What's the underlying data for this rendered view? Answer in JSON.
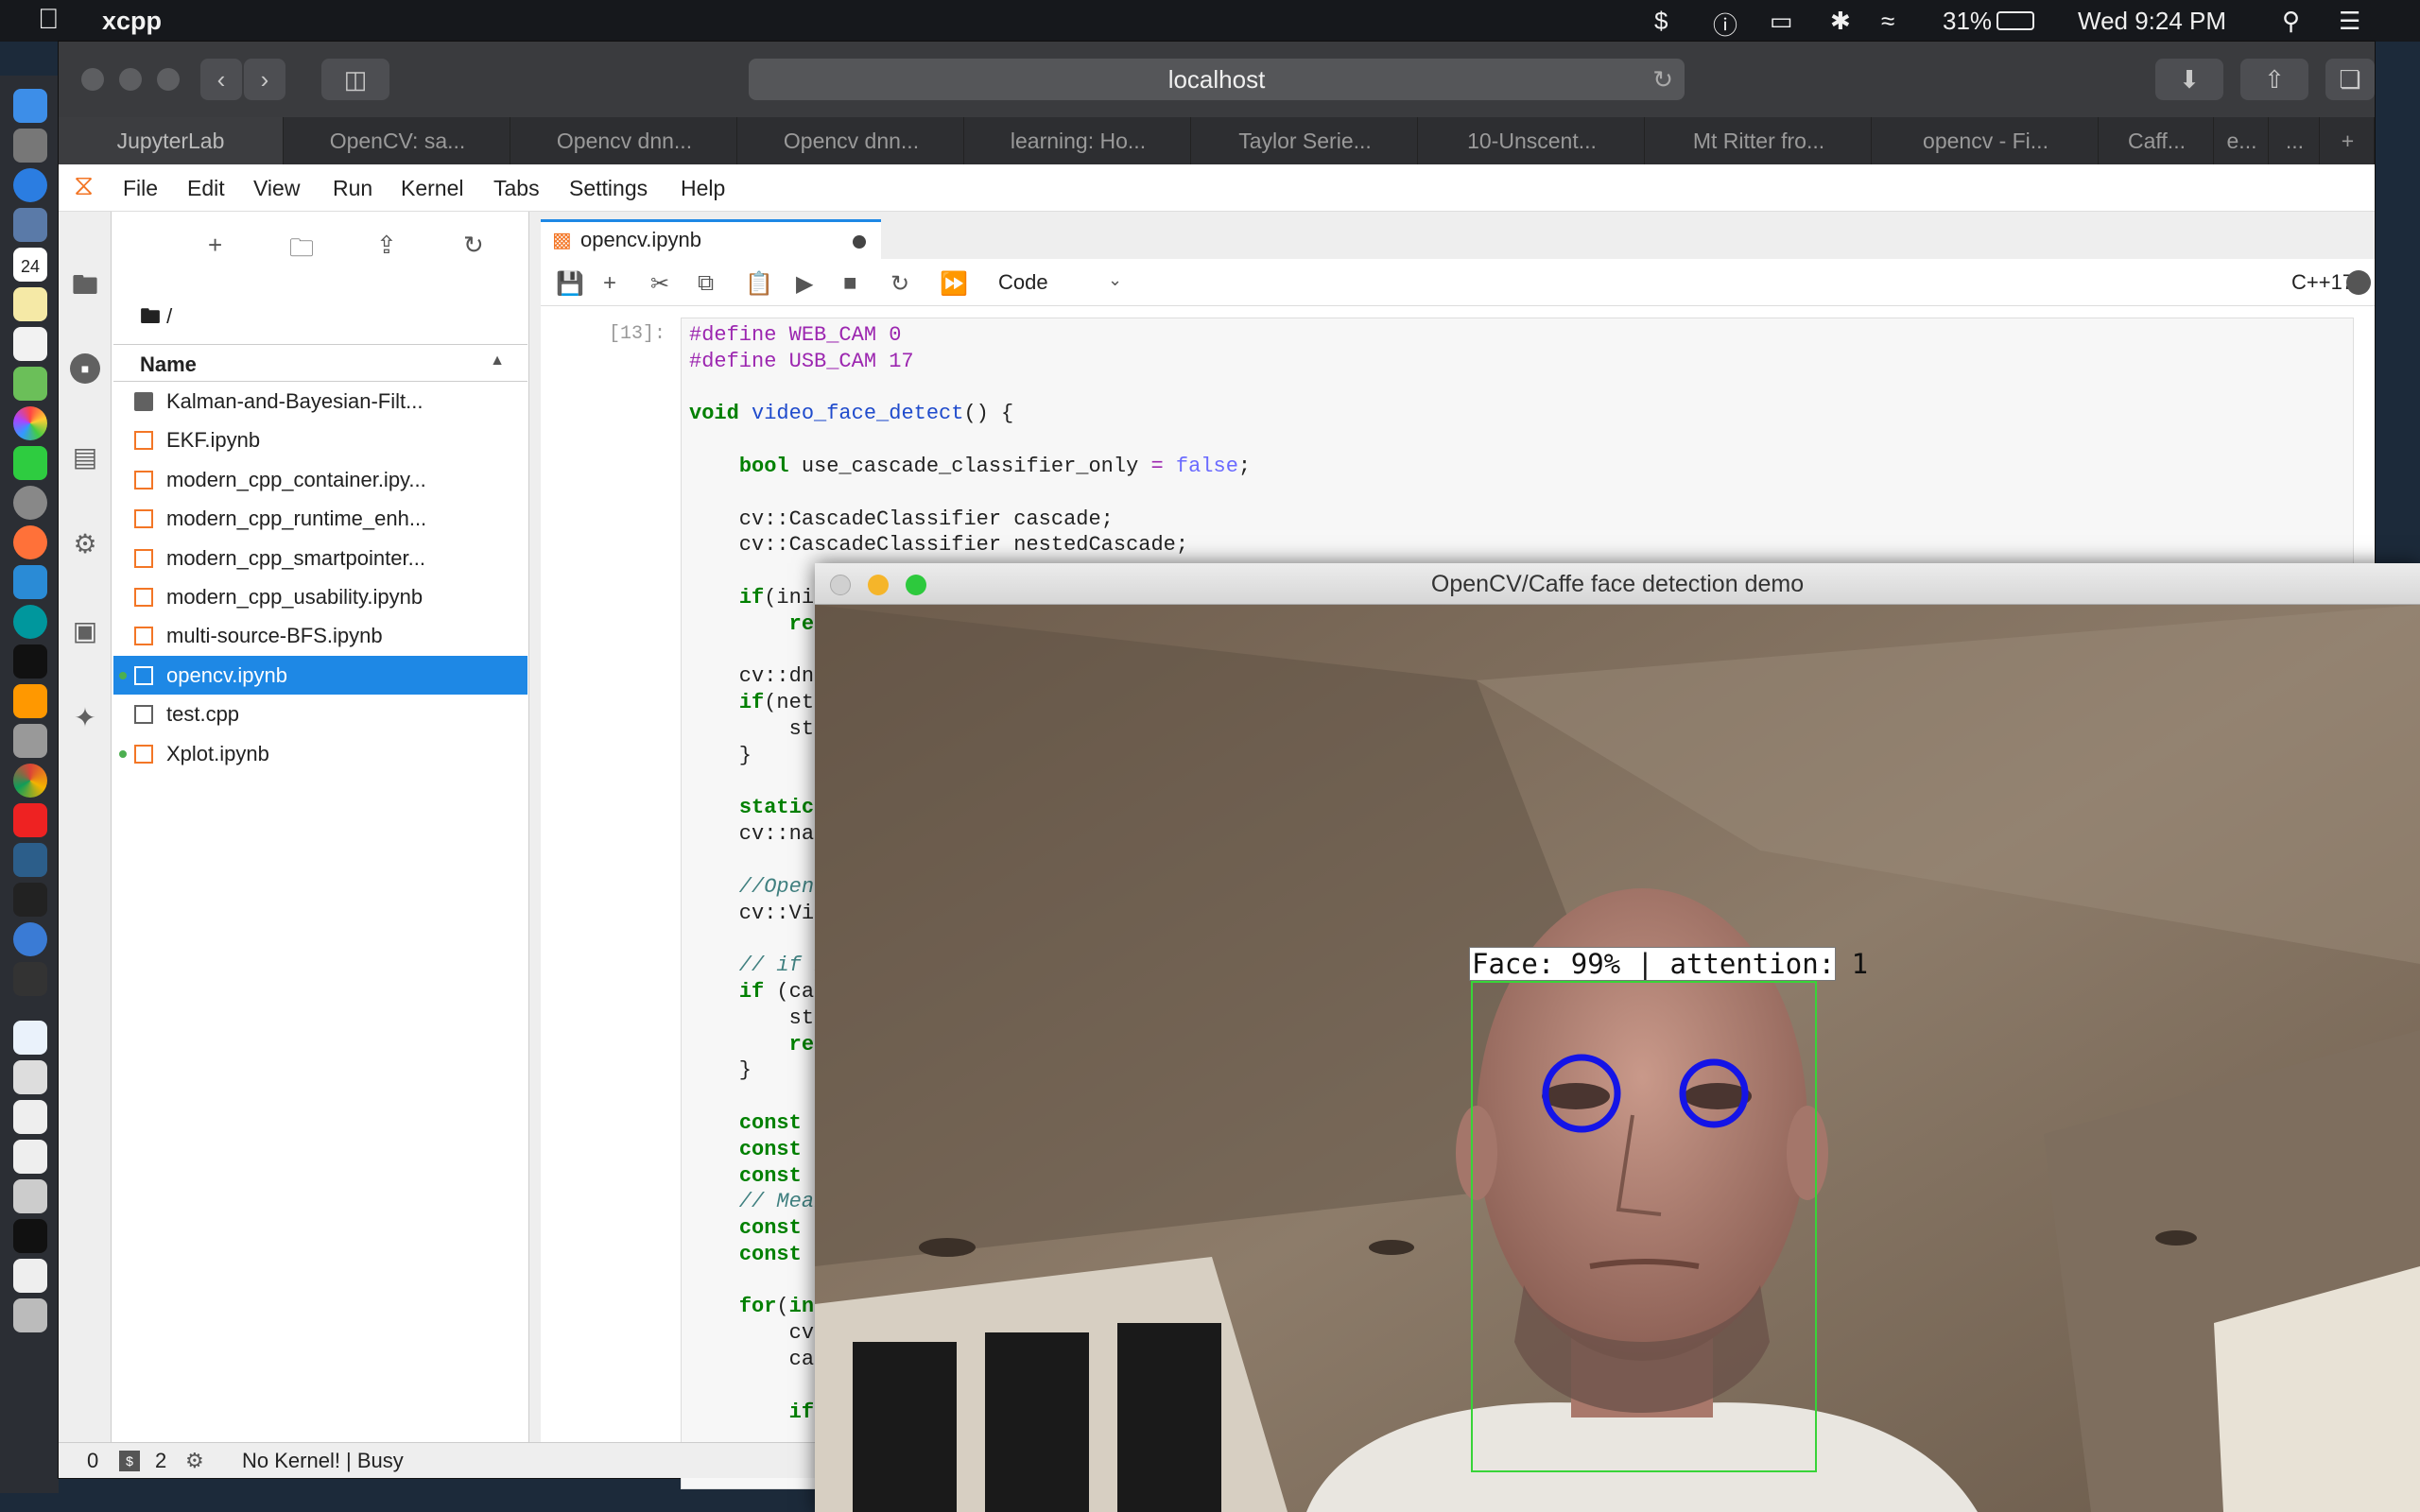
{
  "menubar": {
    "app_name": "xcpp",
    "battery": "31%",
    "clock": "Wed 9:24 PM"
  },
  "dock": {
    "calendar_day": "24"
  },
  "browser": {
    "url": "localhost",
    "tabs": [
      "JupyterLab",
      "OpenCV: sa...",
      "Opencv dnn...",
      "Opencv dnn...",
      "learning: Ho...",
      "Taylor Serie...",
      "10-Unscent...",
      "Mt Ritter fro...",
      "opencv - Fi...",
      "Caff...",
      "e...",
      "..."
    ],
    "new_tab_label": "+"
  },
  "jupyter": {
    "menu": [
      "File",
      "Edit",
      "View",
      "Run",
      "Kernel",
      "Tabs",
      "Settings",
      "Help"
    ],
    "breadcrumb": "/",
    "column_name": "Name",
    "files": [
      {
        "name": "Kalman-and-Bayesian-Filt...",
        "type": "folder",
        "running": false,
        "selected": false
      },
      {
        "name": "EKF.ipynb",
        "type": "notebook",
        "running": false,
        "selected": false
      },
      {
        "name": "modern_cpp_container.ipy...",
        "type": "notebook",
        "running": false,
        "selected": false
      },
      {
        "name": "modern_cpp_runtime_enh...",
        "type": "notebook",
        "running": false,
        "selected": false
      },
      {
        "name": "modern_cpp_smartpointer...",
        "type": "notebook",
        "running": false,
        "selected": false
      },
      {
        "name": "modern_cpp_usability.ipynb",
        "type": "notebook",
        "running": false,
        "selected": false
      },
      {
        "name": "multi-source-BFS.ipynb",
        "type": "notebook",
        "running": false,
        "selected": false
      },
      {
        "name": "opencv.ipynb",
        "type": "notebook",
        "running": true,
        "selected": true
      },
      {
        "name": "test.cpp",
        "type": "file",
        "running": false,
        "selected": false
      },
      {
        "name": "Xplot.ipynb",
        "type": "notebook",
        "running": true,
        "selected": false
      }
    ],
    "notebook_tab": "opencv.ipynb",
    "cell_type": "Code",
    "kernel_name": "C++17",
    "prompt": "[13]:",
    "status": {
      "count_a": "0",
      "count_b": "2",
      "text": "No Kernel! | Busy"
    }
  },
  "code_lines": [
    "#define WEB_CAM 0",
    "#define USB_CAM 17",
    "",
    "void video_face_detect() {",
    "",
    "    bool use_cascade_classifier_only = false;",
    "",
    "    cv::CascadeClassifier cascade;",
    "    cv::CascadeClassifier nestedCascade;",
    "",
    "    if(initiali",
    "        return;",
    "",
    "    cv::dnn::Ne",
    "    if(net.empt",
    "        std::co",
    "    }",
    "",
    "    static cons",
    "    cv::namedWi",
    "",
    "    //Open the",
    "    cv::VideoCa",
    "",
    "    // if not s",
    "    if (cap.isO",
    "        std::co",
    "        return",
    "    }",
    "",
    "    const size_",
    "    const size_",
    "    const doubl",
    "    // Mean sub",
    "    const cv::S",
    "    const doubl",
    "",
    "    for(int k =",
    "        cv::Mat",
    "        cap >>",
    "",
    "        if(fram"
  ],
  "opencv_window": {
    "title": "OpenCV/Caffe face detection demo",
    "face_label": "Face: 99% | attention: 1"
  },
  "colors": {
    "selection": "#1e88e5",
    "running_dot": "#4caf50",
    "face_box": "#38d438",
    "eye_circle": "#1414e6"
  }
}
